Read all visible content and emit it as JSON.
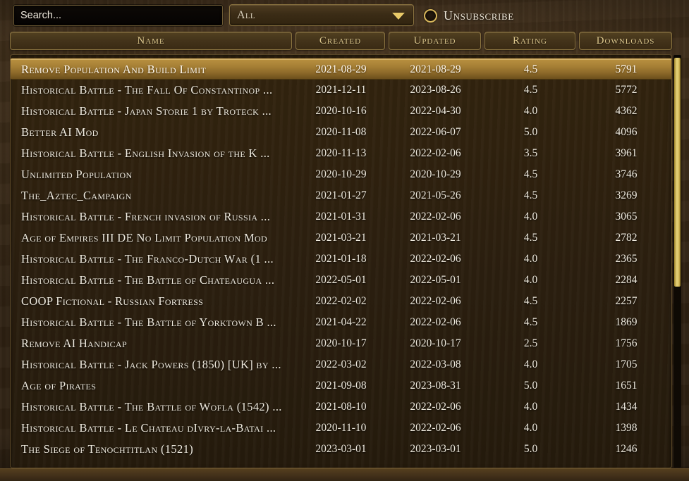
{
  "search": {
    "placeholder": "Search...",
    "value": ""
  },
  "filter": {
    "selected": "All",
    "caret_icon": "chevron-down-icon"
  },
  "unsubscribe": {
    "label": "Unsubscribe",
    "checked": false,
    "radio_icon": "radio-unchecked-icon"
  },
  "colors": {
    "background": "#3a2a17",
    "panel": "#2c2010",
    "accent_gold": "#dfc98e",
    "selection_gold": "#a57f35",
    "scrollbar_thumb": "#e6d27a",
    "text": "#efeade"
  },
  "columns": [
    {
      "key": "name",
      "label": "Name"
    },
    {
      "key": "created",
      "label": "Created"
    },
    {
      "key": "updated",
      "label": "Updated"
    },
    {
      "key": "rating",
      "label": "Rating"
    },
    {
      "key": "downloads",
      "label": "Downloads"
    }
  ],
  "rows": [
    {
      "name": "Remove Population And Build Limit",
      "created": "2021-08-29",
      "updated": "2021-08-29",
      "rating": "4.5",
      "downloads": "5791",
      "selected": true
    },
    {
      "name": "Historical Battle - The Fall Of Constantinop  ...",
      "created": "2021-12-11",
      "updated": "2023-08-26",
      "rating": "4.5",
      "downloads": "5772",
      "selected": false
    },
    {
      "name": "Historical Battle - Japan Storie 1 by Troteck  ...",
      "created": "2020-10-16",
      "updated": "2022-04-30",
      "rating": "4.0",
      "downloads": "4362",
      "selected": false
    },
    {
      "name": "Better AI Mod",
      "created": "2020-11-08",
      "updated": "2022-06-07",
      "rating": "5.0",
      "downloads": "4096",
      "selected": false
    },
    {
      "name": "Historical Battle - English Invasion of the K  ...",
      "created": "2020-11-13",
      "updated": "2022-02-06",
      "rating": "3.5",
      "downloads": "3961",
      "selected": false
    },
    {
      "name": "Unlimited Population",
      "created": "2020-10-29",
      "updated": "2020-10-29",
      "rating": "4.5",
      "downloads": "3746",
      "selected": false
    },
    {
      "name": "The_Aztec_Campaign",
      "created": "2021-01-27",
      "updated": "2021-05-26",
      "rating": "4.5",
      "downloads": "3269",
      "selected": false
    },
    {
      "name": "Historical Battle - French invasion of Russia  ...",
      "created": "2021-01-31",
      "updated": "2022-02-06",
      "rating": "4.0",
      "downloads": "3065",
      "selected": false
    },
    {
      "name": "Age of Empires III DE No Limit Population Mod",
      "created": "2021-03-21",
      "updated": "2021-03-21",
      "rating": "4.5",
      "downloads": "2782",
      "selected": false
    },
    {
      "name": "Historical Battle - The Franco-Dutch War (1  ...",
      "created": "2021-01-18",
      "updated": "2022-02-06",
      "rating": "4.0",
      "downloads": "2365",
      "selected": false
    },
    {
      "name": "Historical Battle - The Battle of Chateaugua  ...",
      "created": "2022-05-01",
      "updated": "2022-05-01",
      "rating": "4.0",
      "downloads": "2284",
      "selected": false
    },
    {
      "name": "COOP Fictional - Russian Fortress",
      "created": "2022-02-02",
      "updated": "2022-02-06",
      "rating": "4.5",
      "downloads": "2257",
      "selected": false
    },
    {
      "name": "Historical Battle - The Battle of Yorktown B  ...",
      "created": "2021-04-22",
      "updated": "2022-02-06",
      "rating": "4.5",
      "downloads": "1869",
      "selected": false
    },
    {
      "name": "Remove AI Handicap",
      "created": "2020-10-17",
      "updated": "2020-10-17",
      "rating": "2.5",
      "downloads": "1756",
      "selected": false
    },
    {
      "name": "Historical Battle - Jack Powers (1850) [UK] by  ...",
      "created": "2022-03-02",
      "updated": "2022-03-08",
      "rating": "4.0",
      "downloads": "1705",
      "selected": false
    },
    {
      "name": "Age of Pirates",
      "created": "2021-09-08",
      "updated": "2023-08-31",
      "rating": "5.0",
      "downloads": "1651",
      "selected": false
    },
    {
      "name": "Historical Battle - The Battle of Wofla (1542)  ...",
      "created": "2021-08-10",
      "updated": "2022-02-06",
      "rating": "4.0",
      "downloads": "1434",
      "selected": false
    },
    {
      "name": "Historical Battle - Le Chateau dIvry-la-Batai  ...",
      "created": "2020-11-10",
      "updated": "2022-02-06",
      "rating": "4.0",
      "downloads": "1398",
      "selected": false
    },
    {
      "name": "The Siege of Tenochtitlan (1521)",
      "created": "2023-03-01",
      "updated": "2023-03-01",
      "rating": "5.0",
      "downloads": "1246",
      "selected": false
    }
  ]
}
